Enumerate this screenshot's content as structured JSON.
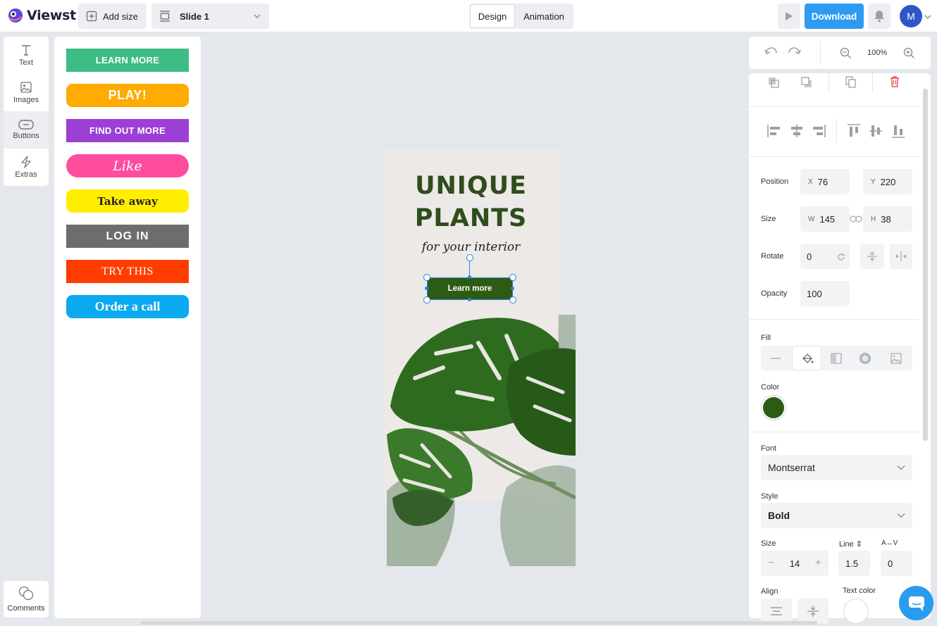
{
  "app": {
    "name": "Viewst"
  },
  "topbar": {
    "add_size": "Add size",
    "slide": "Slide 1",
    "tabs": [
      "Design",
      "Animation"
    ],
    "download": "Download",
    "avatar_initial": "M"
  },
  "tools": [
    {
      "label": "Text",
      "icon": "text-icon"
    },
    {
      "label": "Images",
      "icon": "image-icon"
    },
    {
      "label": "Buttons",
      "icon": "button-icon",
      "active": true
    },
    {
      "label": "Extras",
      "icon": "lightning-icon"
    }
  ],
  "comments_label": "Comments",
  "button_presets": [
    {
      "label": "LEARN MORE",
      "color": "#3dbd84"
    },
    {
      "label": "PLAY!",
      "color": "#ffab00"
    },
    {
      "label": "FIND OUT MORE",
      "color": "#9c3fd4"
    },
    {
      "label": "Like",
      "color": "#ff4d9d"
    },
    {
      "label": "Take away",
      "color": "#ffee00"
    },
    {
      "label": "LOG IN",
      "color": "#6d6d6d"
    },
    {
      "label": "TRY THIS",
      "color": "#ff3d00"
    },
    {
      "label": "Order a call",
      "color": "#0aa9f0"
    }
  ],
  "canvas": {
    "title_line1": "UNIQUE",
    "title_line2": "PLANTS",
    "subtitle": "for your interior",
    "button_label": "Learn more",
    "title_color": "#2e4d1a",
    "button_color": "#2e5b14"
  },
  "zoom": "100%",
  "props": {
    "position_label": "Position",
    "x_prefix": "X",
    "x": "76",
    "y_prefix": "Y",
    "y": "220",
    "size_label": "Size",
    "w_prefix": "W",
    "w": "145",
    "h_prefix": "H",
    "h": "38",
    "rotate_label": "Rotate",
    "rotate": "0",
    "opacity_label": "Opacity",
    "opacity": "100",
    "fill_label": "Fill",
    "color_label": "Color",
    "fill_color": "#2e5b14",
    "font_label": "Font",
    "font": "Montserrat",
    "style_label": "Style",
    "style": "Bold",
    "text_size_label": "Size",
    "text_size": "14",
    "line_label": "Line ⇕",
    "line": "1.5",
    "spacing_label": "A↔V",
    "spacing": "0",
    "align_label": "Align",
    "text_color_label": "Text color"
  }
}
